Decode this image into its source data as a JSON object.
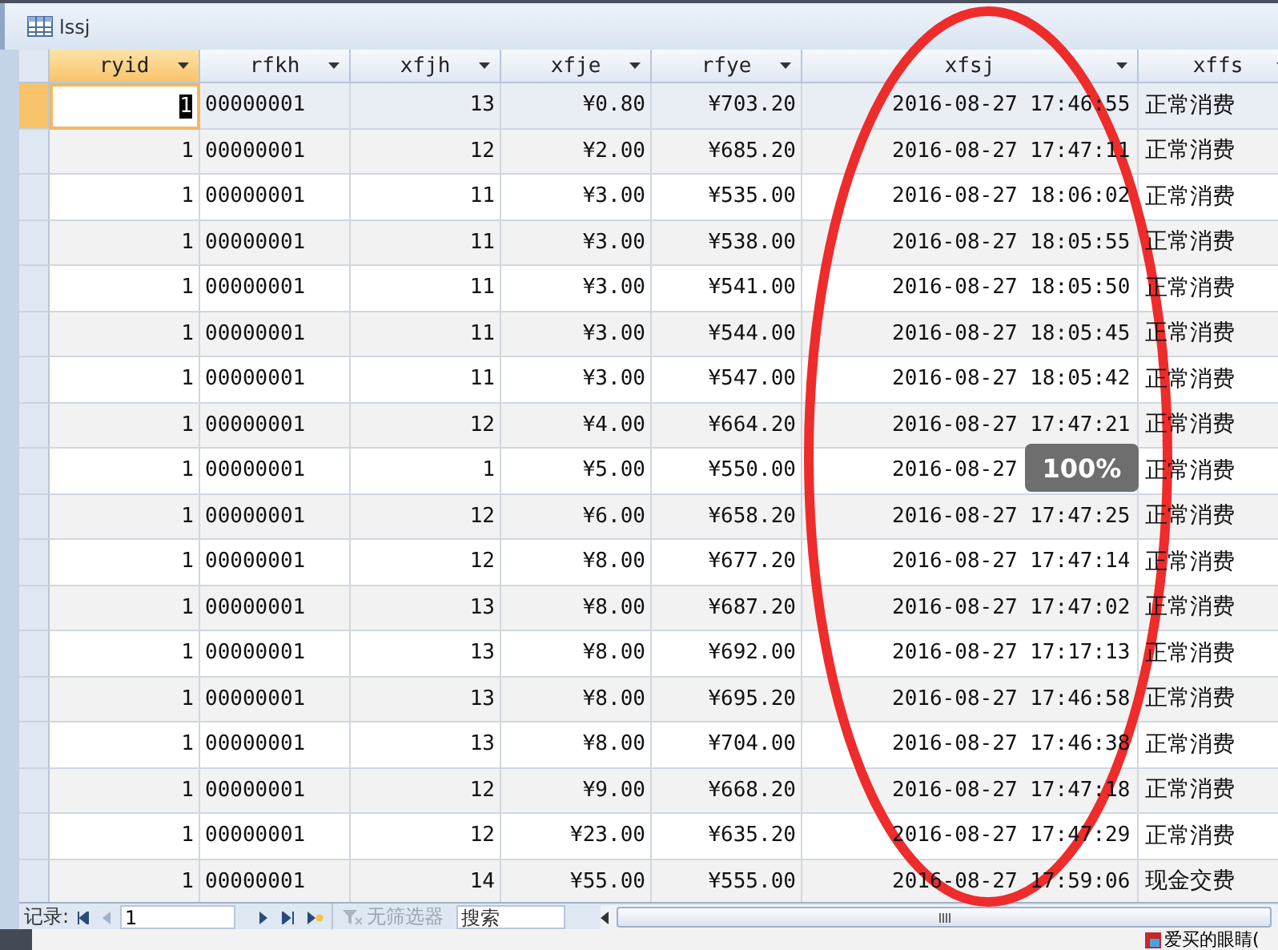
{
  "window": {
    "title": "lssj"
  },
  "table": {
    "columns": [
      {
        "name": "ryid",
        "selected": true
      },
      {
        "name": "rfkh",
        "selected": false
      },
      {
        "name": "xfjh",
        "selected": false
      },
      {
        "name": "xfje",
        "selected": false
      },
      {
        "name": "rfye",
        "selected": false
      },
      {
        "name": "xfsj",
        "selected": false
      },
      {
        "name": "xffs",
        "selected": false
      }
    ],
    "rows": [
      {
        "selected": true,
        "cells": [
          "1",
          "00000001",
          "13",
          "¥0.80",
          "¥703.20",
          "2016-08-27 17:46:55",
          "正常消费"
        ]
      },
      {
        "selected": false,
        "cells": [
          "1",
          "00000001",
          "12",
          "¥2.00",
          "¥685.20",
          "2016-08-27 17:47:11",
          "正常消费"
        ]
      },
      {
        "selected": false,
        "cells": [
          "1",
          "00000001",
          "11",
          "¥3.00",
          "¥535.00",
          "2016-08-27 18:06:02",
          "正常消费"
        ]
      },
      {
        "selected": false,
        "cells": [
          "1",
          "00000001",
          "11",
          "¥3.00",
          "¥538.00",
          "2016-08-27 18:05:55",
          "正常消费"
        ]
      },
      {
        "selected": false,
        "cells": [
          "1",
          "00000001",
          "11",
          "¥3.00",
          "¥541.00",
          "2016-08-27 18:05:50",
          "正常消费"
        ]
      },
      {
        "selected": false,
        "cells": [
          "1",
          "00000001",
          "11",
          "¥3.00",
          "¥544.00",
          "2016-08-27 18:05:45",
          "正常消费"
        ]
      },
      {
        "selected": false,
        "cells": [
          "1",
          "00000001",
          "11",
          "¥3.00",
          "¥547.00",
          "2016-08-27 18:05:42",
          "正常消费"
        ]
      },
      {
        "selected": false,
        "cells": [
          "1",
          "00000001",
          "12",
          "¥4.00",
          "¥664.20",
          "2016-08-27 17:47:21",
          "正常消费"
        ]
      },
      {
        "selected": false,
        "cells": [
          "1",
          "00000001",
          "1",
          "¥5.00",
          "¥550.00",
          "2016-08-27",
          "正常消费"
        ]
      },
      {
        "selected": false,
        "cells": [
          "1",
          "00000001",
          "12",
          "¥6.00",
          "¥658.20",
          "2016-08-27 17:47:25",
          "正常消费"
        ]
      },
      {
        "selected": false,
        "cells": [
          "1",
          "00000001",
          "12",
          "¥8.00",
          "¥677.20",
          "2016-08-27 17:47:14",
          "正常消费"
        ]
      },
      {
        "selected": false,
        "cells": [
          "1",
          "00000001",
          "13",
          "¥8.00",
          "¥687.20",
          "2016-08-27 17:47:02",
          "正常消费"
        ]
      },
      {
        "selected": false,
        "cells": [
          "1",
          "00000001",
          "13",
          "¥8.00",
          "¥692.00",
          "2016-08-27 17:17:13",
          "正常消费"
        ]
      },
      {
        "selected": false,
        "cells": [
          "1",
          "00000001",
          "13",
          "¥8.00",
          "¥695.20",
          "2016-08-27 17:46:58",
          "正常消费"
        ]
      },
      {
        "selected": false,
        "cells": [
          "1",
          "00000001",
          "13",
          "¥8.00",
          "¥704.00",
          "2016-08-27 17:46:38",
          "正常消费"
        ]
      },
      {
        "selected": false,
        "cells": [
          "1",
          "00000001",
          "12",
          "¥9.00",
          "¥668.20",
          "2016-08-27 17:47:18",
          "正常消费"
        ]
      },
      {
        "selected": false,
        "cells": [
          "1",
          "00000001",
          "12",
          "¥23.00",
          "¥635.20",
          "2016-08-27 17:47:29",
          "正常消费"
        ]
      },
      {
        "selected": false,
        "cells": [
          "1",
          "00000001",
          "14",
          "¥55.00",
          "¥555.00",
          "2016-08-27 17:59:06",
          "现金交费"
        ]
      }
    ]
  },
  "zoom_tooltip": "100%",
  "navigator": {
    "label": "记录:",
    "record": "1",
    "filter": {
      "label": "无筛选器",
      "disabled": true
    },
    "search": {
      "placeholder": "搜索"
    }
  },
  "taskbar": {
    "item": "爱买的眼睛("
  }
}
